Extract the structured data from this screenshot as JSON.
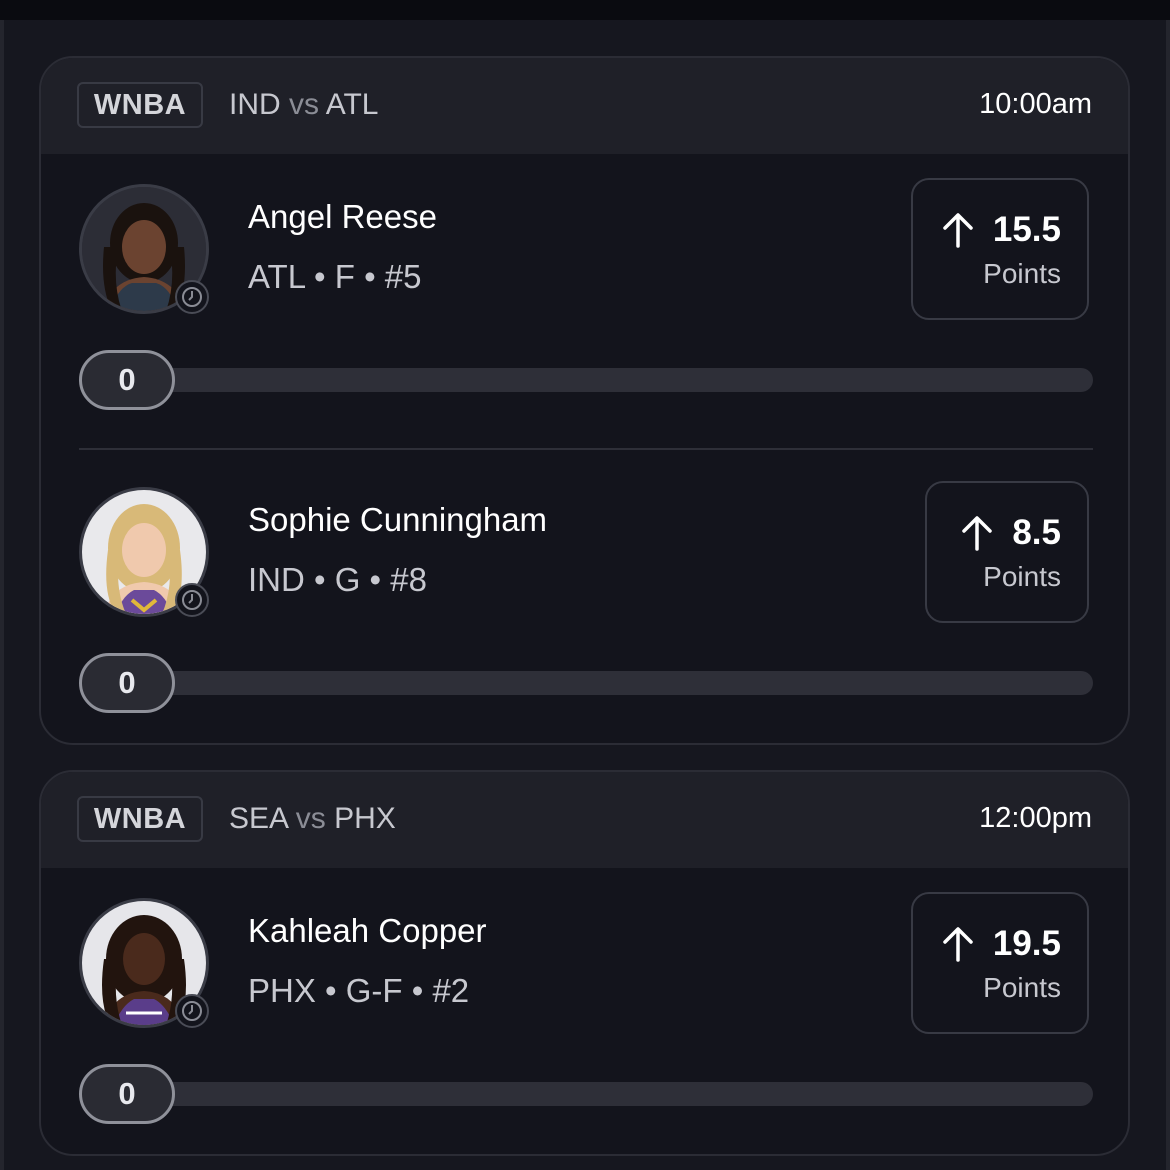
{
  "games": [
    {
      "league": "WNBA",
      "team_a": "IND",
      "vs": "vs",
      "team_b": "ATL",
      "time": "10:00am",
      "players": [
        {
          "name": "Angel Reese",
          "meta": "ATL • F • #5",
          "direction_icon": "arrow-up-icon",
          "line": "15.5",
          "stat": "Points",
          "progress": "0",
          "progress_fraction": 0
        },
        {
          "name": "Sophie Cunningham",
          "meta": "IND • G • #8",
          "direction_icon": "arrow-up-icon",
          "line": "8.5",
          "stat": "Points",
          "progress": "0",
          "progress_fraction": 0
        }
      ]
    },
    {
      "league": "WNBA",
      "team_a": "SEA",
      "vs": "vs",
      "team_b": "PHX",
      "time": "12:00pm",
      "players": [
        {
          "name": "Kahleah Copper",
          "meta": "PHX • G-F • #2",
          "direction_icon": "arrow-up-icon",
          "line": "19.5",
          "stat": "Points",
          "progress": "0",
          "progress_fraction": 0
        }
      ]
    }
  ],
  "colors": {
    "background": "#16171f",
    "card": "#13141c",
    "header": "#1f2028",
    "track": "#2e2f38",
    "pill_border": "#8f919a"
  }
}
